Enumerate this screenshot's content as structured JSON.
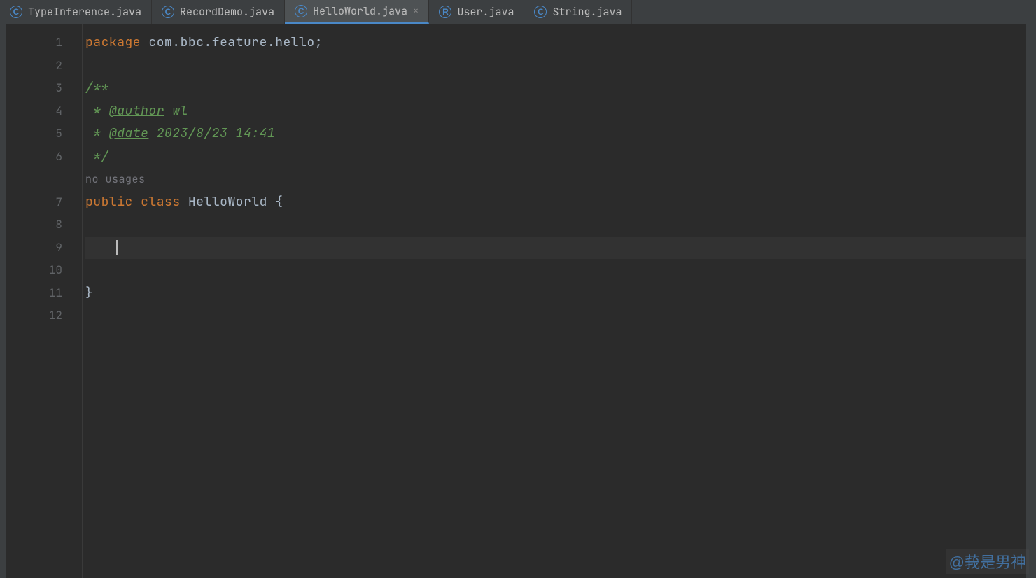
{
  "tabs": [
    {
      "icon": "C",
      "iconType": "class",
      "label": "TypeInference.java",
      "active": false,
      "closable": false
    },
    {
      "icon": "C",
      "iconType": "class",
      "label": "RecordDemo.java",
      "active": false,
      "closable": false
    },
    {
      "icon": "C",
      "iconType": "class",
      "label": "HelloWorld.java",
      "active": true,
      "closable": true
    },
    {
      "icon": "R",
      "iconType": "record",
      "label": "User.java",
      "active": false,
      "closable": false
    },
    {
      "icon": "C",
      "iconType": "class",
      "label": "String.java",
      "active": false,
      "closable": false
    }
  ],
  "closeGlyph": "×",
  "lineNumbers": [
    "1",
    "2",
    "3",
    "4",
    "5",
    "6",
    "",
    "7",
    "8",
    "9",
    "10",
    "11",
    "12"
  ],
  "code": {
    "line1": {
      "kw": "package",
      "rest": " com.bbc.feature.hello;"
    },
    "line3": "/**",
    "line4": {
      "prefix": " * ",
      "tag": "@author",
      "rest": " wl"
    },
    "line5": {
      "prefix": " * ",
      "tag": "@date",
      "rest": " 2023/8/23 14:41"
    },
    "line6": " */",
    "hint": "no usages",
    "line7": {
      "kw1": "public",
      "kw2": "class",
      "name": " HelloWorld ",
      "brace": "{"
    },
    "line11": "}"
  },
  "watermark": "@莪是男神"
}
